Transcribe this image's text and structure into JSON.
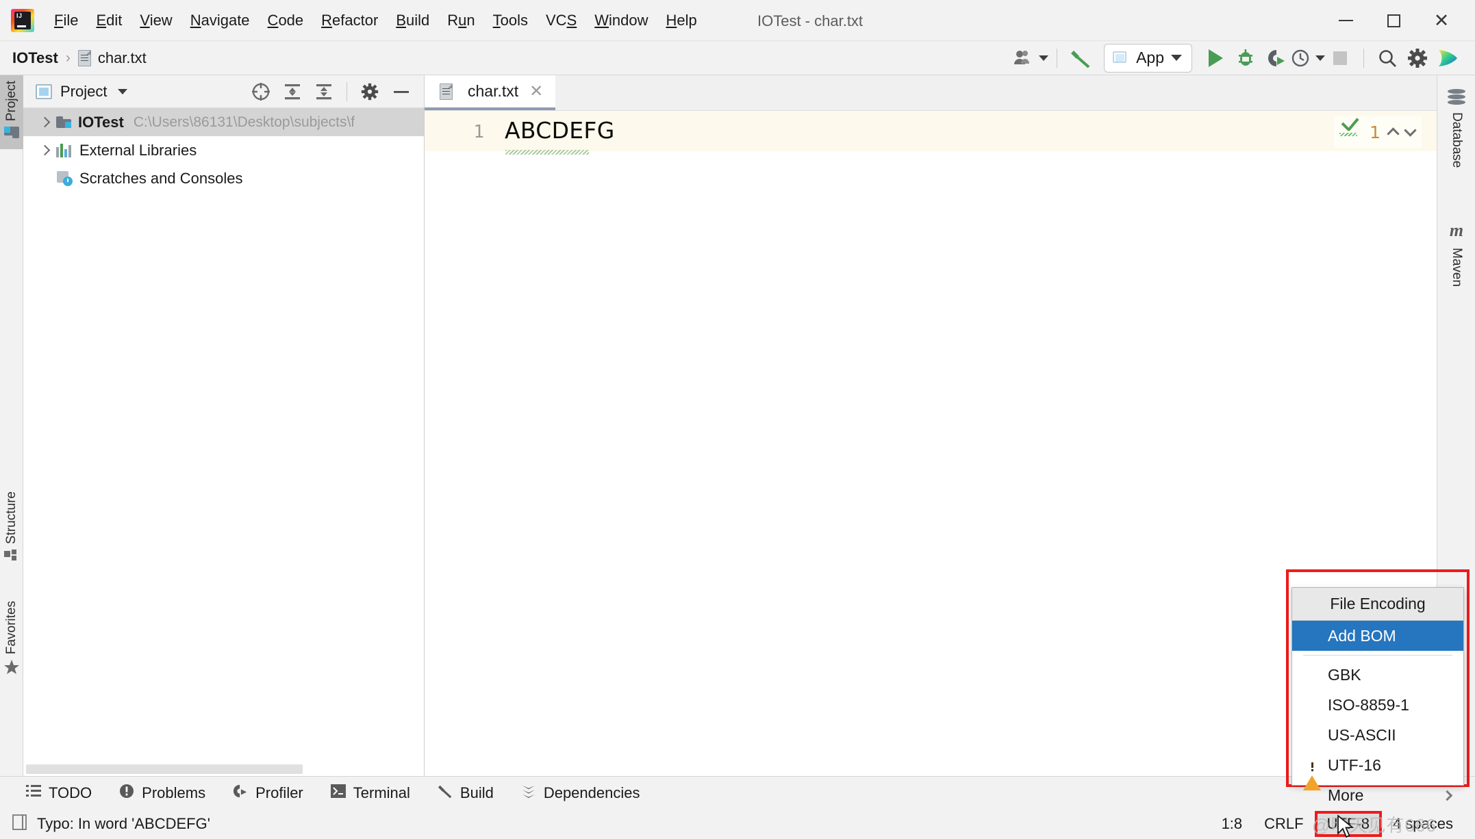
{
  "window": {
    "title": "IOTest - char.txt",
    "logo_icon": "intellij-idea-logo",
    "minimize_icon": "minimize-icon",
    "maximize_icon": "maximize-icon",
    "close_icon": "close-icon"
  },
  "menubar": {
    "items": [
      {
        "label": "File",
        "mnemonic": "F"
      },
      {
        "label": "Edit",
        "mnemonic": "E"
      },
      {
        "label": "View",
        "mnemonic": "V"
      },
      {
        "label": "Navigate",
        "mnemonic": "N"
      },
      {
        "label": "Code",
        "mnemonic": "C"
      },
      {
        "label": "Refactor",
        "mnemonic": "R"
      },
      {
        "label": "Build",
        "mnemonic": "B"
      },
      {
        "label": "Run",
        "mnemonic": "u"
      },
      {
        "label": "Tools",
        "mnemonic": "T"
      },
      {
        "label": "VCS",
        "mnemonic": "S"
      },
      {
        "label": "Window",
        "mnemonic": "W"
      },
      {
        "label": "Help",
        "mnemonic": "H"
      }
    ]
  },
  "navbar": {
    "breadcrumb": {
      "project": "IOTest",
      "separator": "›",
      "file": "char.txt",
      "file_icon": "text-file-icon"
    },
    "toolbar": {
      "user_icon": "user-accounts-icon",
      "build_icon": "build-hammer-icon",
      "run_config": {
        "label": "App",
        "icon": "app-window-icon",
        "dropdown_icon": "chevron-down-icon"
      },
      "run_icon": "run-play-icon",
      "debug_icon": "debug-bug-icon",
      "run_coverage_icon": "run-with-coverage-icon",
      "profiler_icon": "profiler-clock-icon",
      "stop_icon": "stop-square-icon",
      "search_icon": "search-icon",
      "settings_icon": "settings-gear-icon",
      "ide_assistant_icon": "ide-assistant-icon"
    }
  },
  "left_tool_strip": {
    "tabs": [
      {
        "label": "Project",
        "icon": "project-folder-icon",
        "selected": true
      },
      {
        "label": "Structure",
        "icon": "structure-icon",
        "selected": false
      },
      {
        "label": "Favorites",
        "icon": "favorites-star-icon",
        "selected": false
      }
    ]
  },
  "right_tool_strip": {
    "tabs": [
      {
        "label": "Database",
        "icon": "database-icon"
      },
      {
        "label": "Maven",
        "icon": "maven-m-icon"
      }
    ]
  },
  "project_panel": {
    "title": "Project",
    "view_icon": "project-view-icon",
    "dropdown_icon": "chevron-down-icon",
    "actions": [
      {
        "name": "select-opened-file",
        "icon": "crosshair-target-icon"
      },
      {
        "name": "expand-all",
        "icon": "expand-all-icon"
      },
      {
        "name": "collapse-all",
        "icon": "collapse-all-icon"
      },
      {
        "name": "settings",
        "icon": "settings-gear-icon"
      },
      {
        "name": "hide",
        "icon": "minimize-dash-icon"
      }
    ],
    "tree": [
      {
        "label": "IOTest",
        "path": "C:\\Users\\86131\\Desktop\\subjects\\f",
        "icon": "module-folder-icon",
        "expandable": true,
        "bold": true,
        "selected": true,
        "indent": 0
      },
      {
        "label": "External Libraries",
        "path": "",
        "icon": "external-libraries-icon",
        "expandable": true,
        "bold": false,
        "selected": false,
        "indent": 0
      },
      {
        "label": "Scratches and Consoles",
        "path": "",
        "icon": "scratches-consoles-icon",
        "expandable": false,
        "bold": false,
        "selected": false,
        "indent": 0
      }
    ]
  },
  "editor": {
    "tabs": [
      {
        "label": "char.txt",
        "icon": "text-file-icon",
        "close_icon": "close-icon",
        "active": true
      }
    ],
    "line_number": "1",
    "content": "ABCDEFG",
    "inspection_widget": {
      "status_icon": "inspection-ok-icon",
      "count": "1",
      "prev_icon": "chevron-up-icon",
      "next_icon": "chevron-down-icon"
    }
  },
  "bottom_toolbar": {
    "items": [
      {
        "label": "TODO",
        "icon": "todo-list-icon"
      },
      {
        "label": "Problems",
        "icon": "problems-icon"
      },
      {
        "label": "Profiler",
        "icon": "profiler-icon"
      },
      {
        "label": "Terminal",
        "icon": "terminal-icon"
      },
      {
        "label": "Build",
        "icon": "build-hammer-icon"
      },
      {
        "label": "Dependencies",
        "icon": "dependencies-icon"
      }
    ]
  },
  "statusbar": {
    "message_icon": "document-status-icon",
    "message": "Typo: In word 'ABCDEFG'",
    "caret_position": "1:8",
    "line_separator": "CRLF",
    "encoding": "UTF-8",
    "indent": "4 spaces",
    "watermark": "@明天见有666"
  },
  "popup": {
    "title": "File Encoding",
    "items": [
      {
        "label": "Add BOM",
        "selected": true,
        "warning": false,
        "submenu": false
      },
      {
        "label": "GBK",
        "selected": false,
        "warning": false,
        "submenu": false
      },
      {
        "label": "ISO-8859-1",
        "selected": false,
        "warning": false,
        "submenu": false
      },
      {
        "label": "US-ASCII",
        "selected": false,
        "warning": false,
        "submenu": false
      },
      {
        "label": "UTF-16",
        "selected": false,
        "warning": true,
        "submenu": false
      },
      {
        "label": "More",
        "selected": false,
        "warning": false,
        "submenu": true
      }
    ],
    "highlight_color": "#2675bf",
    "outline_color": "#ee1b1b",
    "warning_icon": "warning-triangle-icon",
    "submenu_icon": "chevron-right-icon"
  },
  "colors": {
    "accent_blue": "#2675bf",
    "alert_red": "#ee1b1b",
    "run_green": "#499c54",
    "caret_line": "#fdf9ec"
  }
}
